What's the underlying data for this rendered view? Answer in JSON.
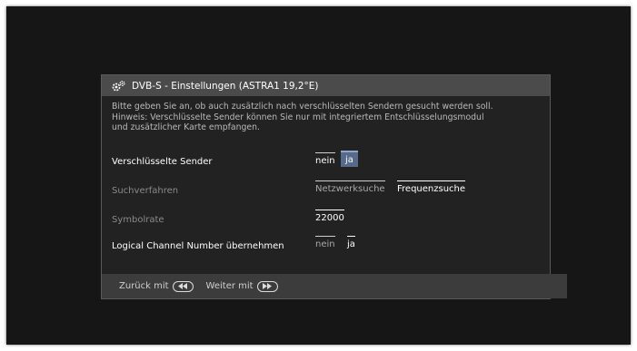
{
  "dialog": {
    "title": "DVB-S - Einstellungen (ASTRA1 19,2°E)",
    "icon": "gear-icon"
  },
  "hint": {
    "line1": "Bitte geben Sie an, ob auch zusätzlich nach verschlüsselten Sendern gesucht werden soll.",
    "line2": "Hinweis: Verschlüsselte Sender können Sie nur mit integriertem Entschlüsselungsmodul",
    "line3": "und zusätzlicher Karte empfangen."
  },
  "settings": {
    "encrypted": {
      "label": "Verschlüsselte Sender",
      "options": [
        "nein",
        "ja"
      ],
      "selected": "ja"
    },
    "search_method": {
      "label": "Suchverfahren",
      "options": [
        "Netzwerksuche",
        "Frequenzsuche"
      ],
      "selected": "Frequenzsuche"
    },
    "symbol_rate": {
      "label": "Symbolrate",
      "value": "22000"
    },
    "lcn": {
      "label": "Logical Channel Number übernehmen",
      "options": [
        "nein",
        "ja"
      ],
      "selected": "ja"
    }
  },
  "footer": {
    "back": "Zurück mit",
    "back_icon": "rewind-icon",
    "next": "Weiter mit",
    "next_icon": "fast-forward-icon"
  },
  "colors": {
    "selection": "#566a8a",
    "header": "#4b4b4b",
    "panel": "#222222"
  }
}
